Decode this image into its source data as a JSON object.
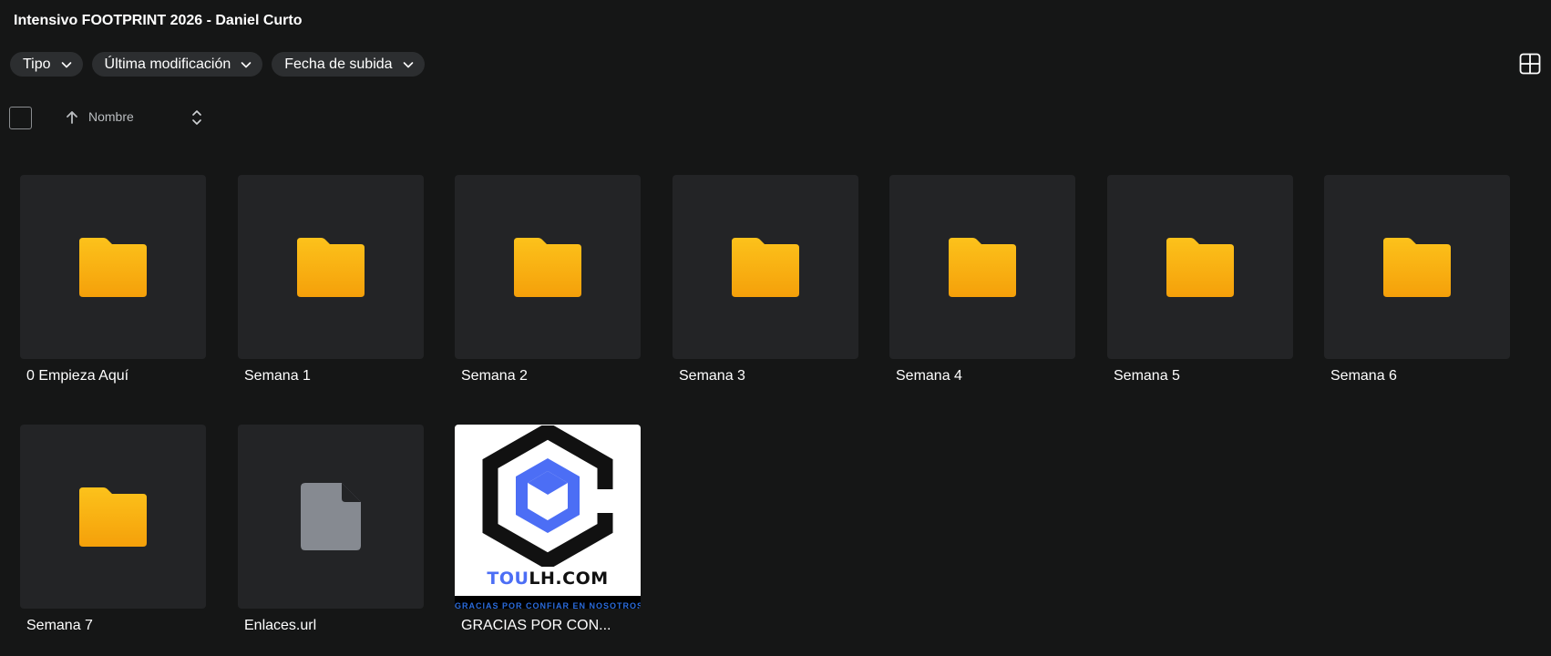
{
  "header": {
    "title": "Intensivo FOOTPRINT 2026 - Daniel Curto"
  },
  "filters": [
    {
      "label": "Tipo"
    },
    {
      "label": "Última modificación"
    },
    {
      "label": "Fecha de subida"
    }
  ],
  "sort": {
    "label": "Nombre"
  },
  "items": [
    {
      "name": "0 Empieza Aquí",
      "type": "folder"
    },
    {
      "name": "Semana 1",
      "type": "folder"
    },
    {
      "name": "Semana 2",
      "type": "folder"
    },
    {
      "name": "Semana 3",
      "type": "folder"
    },
    {
      "name": "Semana 4",
      "type": "folder"
    },
    {
      "name": "Semana 5",
      "type": "folder"
    },
    {
      "name": "Semana 6",
      "type": "folder"
    },
    {
      "name": "Semana 7",
      "type": "folder"
    },
    {
      "name": "Enlaces.url",
      "type": "file"
    },
    {
      "name": "GRACIAS POR CON...",
      "type": "image"
    }
  ],
  "thumbnail": {
    "logo_text_blue": "TOU",
    "logo_text_black": "LH.COM",
    "strip_text": "GRACIAS POR CONFIAR EN NOSOTROS"
  },
  "colors": {
    "background": "#151616",
    "tile": "#232426",
    "chip": "#2c2e30",
    "folder_top": "#fcc21b",
    "folder_bottom": "#f5a00a",
    "file": "#868a91",
    "logo_blue": "#4c6ef5"
  },
  "icons": {
    "view_toggle": "grid-view-icon",
    "sort_direction": "arrow-up-icon",
    "sort_toggle": "sort-updown-icon",
    "folder": "folder-icon",
    "file": "file-icon"
  }
}
